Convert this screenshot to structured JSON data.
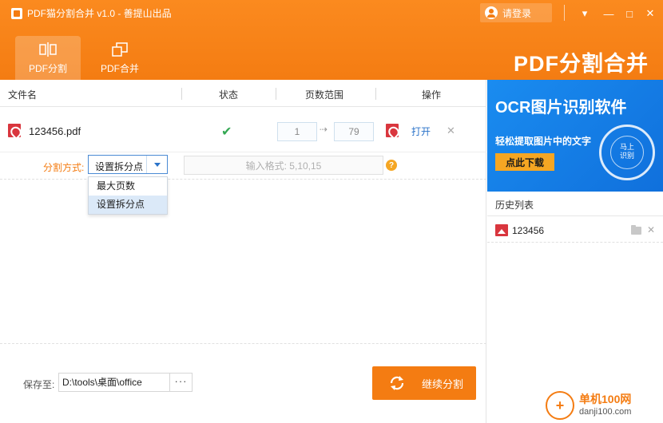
{
  "window": {
    "title": "PDF猫分割合并 v1.0 - 善提山出品",
    "login_label": "请登录",
    "controls": [
      "▾",
      "—",
      "□",
      "✕"
    ]
  },
  "tabs": [
    {
      "label": "PDF分割",
      "icon": "split-icon",
      "active": true
    },
    {
      "label": "PDF合并",
      "icon": "merge-icon",
      "active": false
    }
  ],
  "brand": "PDF分割合并",
  "table": {
    "headers": {
      "filename": "文件名",
      "status": "状态",
      "page_range": "页数范围",
      "action": "操作"
    },
    "rows": [
      {
        "filename": "123456.pdf",
        "status": "ok",
        "page_from": "1",
        "page_to": "79",
        "open": "打开",
        "delete": "✕"
      }
    ]
  },
  "split": {
    "label": "分割方式:",
    "selected": "设置拆分点",
    "options": [
      "最大页数",
      "设置拆分点"
    ],
    "format_placeholder": "输入格式: 5,10,15",
    "help": "?"
  },
  "footer": {
    "save_label": "保存至:",
    "save_path": "D:\\tools\\桌面\\office",
    "browse": "···",
    "continue_label": "继续分割"
  },
  "ad": {
    "title": "OCR图片识别软件",
    "subtitle": "轻松提取图片中的文字",
    "button": "点此下载",
    "circle_text_1": "马上",
    "circle_text_2": "识别"
  },
  "history": {
    "title": "历史列表",
    "items": [
      {
        "name": "123456",
        "delete": "✕"
      }
    ]
  },
  "watermark": {
    "cn": "单机100网",
    "url": "danji100.com"
  },
  "colors": {
    "accent": "#f47c12",
    "link": "#2b73c9",
    "ok": "#34a853",
    "pdf": "#d9363e",
    "ad_blue": "#1a8cf0"
  }
}
